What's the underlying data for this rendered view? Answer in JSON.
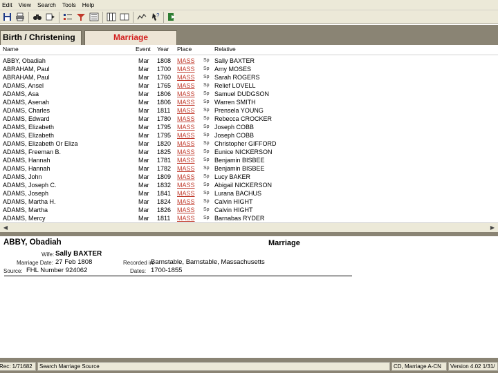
{
  "menu": [
    "Edit",
    "View",
    "Search",
    "Tools",
    "Help"
  ],
  "toolbar": [
    "save-icon",
    "print-icon",
    "find-icon",
    "prev-next-icon",
    "expand-icon",
    "filter-icon",
    "list-icon",
    "columns-icon",
    "book-icon",
    "chart-icon",
    "help-icon",
    "exit-icon"
  ],
  "tabs": {
    "birth": "Birth / Christening",
    "marriage": "Marriage",
    "active_color": "#d31e1e"
  },
  "columns": {
    "name": "Name",
    "event": "Event",
    "year": "Year",
    "place": "Place",
    "relative": "Relative"
  },
  "rows": [
    {
      "name": "ABBY, Obadiah",
      "event": "Mar",
      "year": "1808",
      "place": "MASS",
      "rel_type": "Sp",
      "relative": "Sally BAXTER"
    },
    {
      "name": "ABRAHAM, Paul",
      "event": "Mar",
      "year": "1700",
      "place": "MASS",
      "rel_type": "Sp",
      "relative": "Amy MOSES"
    },
    {
      "name": "ABRAHAM, Paul",
      "event": "Mar",
      "year": "1760",
      "place": "MASS",
      "rel_type": "Sp",
      "relative": "Sarah ROGERS"
    },
    {
      "name": "ADAMS, Ansel",
      "event": "Mar",
      "year": "1765",
      "place": "MASS",
      "rel_type": "Sp",
      "relative": "Relief LOVELL"
    },
    {
      "name": "ADAMS, Asa",
      "event": "Mar",
      "year": "1806",
      "place": "MASS",
      "rel_type": "Sp",
      "relative": "Samuel DUDGSON"
    },
    {
      "name": "ADAMS, Asenah",
      "event": "Mar",
      "year": "1806",
      "place": "MASS",
      "rel_type": "Sp",
      "relative": "Warren SMITH"
    },
    {
      "name": "ADAMS, Charles",
      "event": "Mar",
      "year": "1811",
      "place": "MASS",
      "rel_type": "Sp",
      "relative": "Prensela YOUNG"
    },
    {
      "name": "ADAMS, Edward",
      "event": "Mar",
      "year": "1780",
      "place": "MASS",
      "rel_type": "Sp",
      "relative": "Rebecca CROCKER"
    },
    {
      "name": "ADAMS, Elizabeth",
      "event": "Mar",
      "year": "1795",
      "place": "MASS",
      "rel_type": "Sp",
      "relative": "Joseph COBB"
    },
    {
      "name": "ADAMS, Elizabeth",
      "event": "Mar",
      "year": "1795",
      "place": "MASS",
      "rel_type": "Sp",
      "relative": "Joseph COBB"
    },
    {
      "name": "ADAMS, Elizabeth Or Eliza",
      "event": "Mar",
      "year": "1820",
      "place": "MASS",
      "rel_type": "Sp",
      "relative": "Christopher GIFFORD"
    },
    {
      "name": "ADAMS, Freeman B.",
      "event": "Mar",
      "year": "1825",
      "place": "MASS",
      "rel_type": "Sp",
      "relative": "Eunice NICKERSON"
    },
    {
      "name": "ADAMS, Hannah",
      "event": "Mar",
      "year": "1781",
      "place": "MASS",
      "rel_type": "Sp",
      "relative": "Benjamin BISBEE"
    },
    {
      "name": "ADAMS, Hannah",
      "event": "Mar",
      "year": "1782",
      "place": "MASS",
      "rel_type": "Sp",
      "relative": "Benjamin BISBEE"
    },
    {
      "name": "ADAMS, John",
      "event": "Mar",
      "year": "1809",
      "place": "MASS",
      "rel_type": "Sp",
      "relative": "Lucy BAKER"
    },
    {
      "name": "ADAMS, Joseph C.",
      "event": "Mar",
      "year": "1832",
      "place": "MASS",
      "rel_type": "Sp",
      "relative": "Abigail NICKERSON"
    },
    {
      "name": "ADAMS, Joseph",
      "event": "Mar",
      "year": "1841",
      "place": "MASS",
      "rel_type": "Sp",
      "relative": "Lurana BACHUS"
    },
    {
      "name": "ADAMS, Martha H.",
      "event": "Mar",
      "year": "1824",
      "place": "MASS",
      "rel_type": "Sp",
      "relative": "Calvin HIGHT"
    },
    {
      "name": "ADAMS, Martha",
      "event": "Mar",
      "year": "1826",
      "place": "MASS",
      "rel_type": "Sp",
      "relative": "Calvin HIGHT"
    },
    {
      "name": "ADAMS, Mercy",
      "event": "Mar",
      "year": "1811",
      "place": "MASS",
      "rel_type": "Sp",
      "relative": "Barnabas RYDER"
    }
  ],
  "detail": {
    "name": "ABBY, Obadiah",
    "event": "Marriage",
    "wife_label": "Wife:",
    "wife": "Sally BAXTER",
    "date_label": "Marriage Date:",
    "date": "27 Feb 1808",
    "recorded_label": "Recorded in:",
    "recorded": "Barnstable, Barnstable, Massachusetts",
    "source_label": "Source:",
    "source": "FHL Number 924062",
    "dates_label": "Dates:",
    "dates": "1700-1855"
  },
  "status": {
    "record": "Rec: 1/71682",
    "search": "Search Marriage Source",
    "cd": "CD, Marriage A-CN",
    "version": "Version 4.02 1/31/"
  }
}
